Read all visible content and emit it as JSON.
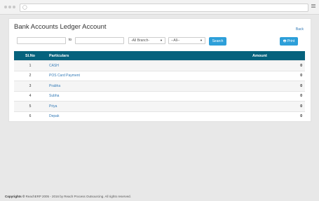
{
  "page": {
    "title": "Bank Accounts Ledger Account",
    "back_label": "Back"
  },
  "filters": {
    "to_label": "to",
    "branch_select": "-All Branch-",
    "all_select": "--All--",
    "search_label": "Search",
    "print_label": "Print"
  },
  "table": {
    "headers": {
      "no": "Sl.No",
      "particulars": "Particulars",
      "amount": "Amount"
    },
    "rows": [
      {
        "no": "1",
        "particulars": "CASH",
        "amount": "0"
      },
      {
        "no": "2",
        "particulars": "POS Card Payment",
        "amount": "0"
      },
      {
        "no": "3",
        "particulars": "Prabha",
        "amount": "0"
      },
      {
        "no": "4",
        "particulars": "Subha",
        "amount": "0"
      },
      {
        "no": "5",
        "particulars": "Priya",
        "amount": "0"
      },
      {
        "no": "6",
        "particulars": "Depak",
        "amount": "0"
      }
    ]
  },
  "footer": {
    "bold": "Copyrights ©",
    "text": " ReachERP 2005 - 2016 by Reach Process Outsourcing. All rights reserved."
  },
  "icons": {
    "address_icon": "page-icon",
    "menu_icon": "hamburger-icon",
    "print_icon": "printer-icon",
    "caret_icon": "caret-down-icon"
  },
  "colors": {
    "header": "#06627d",
    "button": "#2d9fd9",
    "link": "#337ab7"
  }
}
